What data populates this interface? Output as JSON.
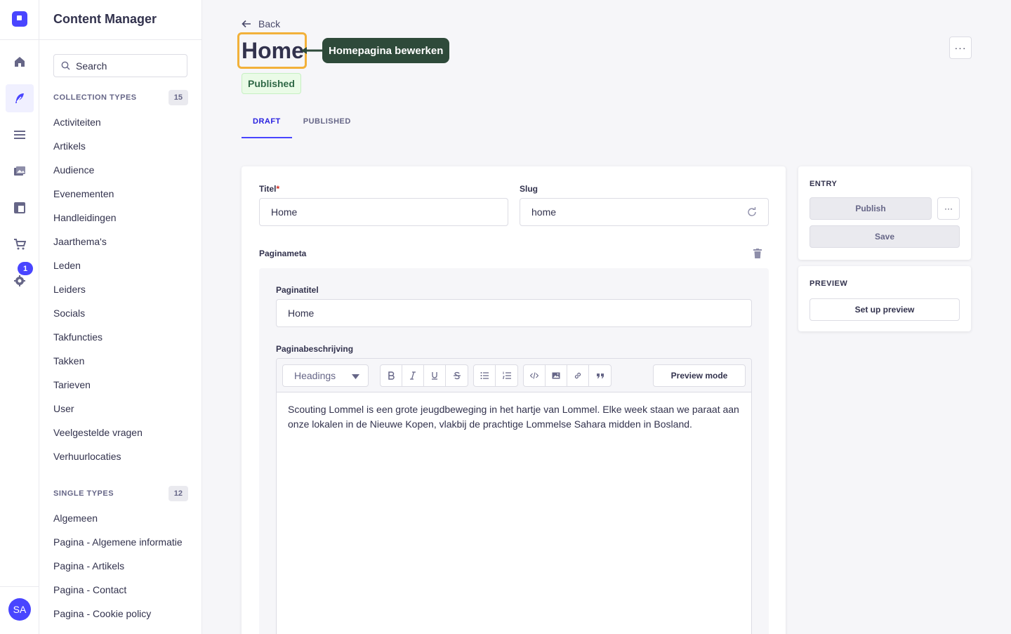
{
  "rail": {
    "items": [
      "home-icon",
      "feather-icon",
      "list-icon",
      "image-icon",
      "layout-icon",
      "cart-icon",
      "gear-icon"
    ],
    "settings_badge": "1",
    "avatar_initials": "SA",
    "accent": "#4945ff"
  },
  "subnav": {
    "title": "Content Manager",
    "search_placeholder": "Search",
    "collection_types": {
      "label": "COLLECTION TYPES",
      "count": "15",
      "items": [
        "Activiteiten",
        "Artikels",
        "Audience",
        "Evenementen",
        "Handleidingen",
        "Jaarthema's",
        "Leden",
        "Leiders",
        "Socials",
        "Takfuncties",
        "Takken",
        "Tarieven",
        "User",
        "Veelgestelde vragen",
        "Verhuurlocaties"
      ]
    },
    "single_types": {
      "label": "SINGLE TYPES",
      "count": "12",
      "items": [
        "Algemeen",
        "Pagina - Algemene informatie",
        "Pagina - Artikels",
        "Pagina - Contact",
        "Pagina - Cookie policy"
      ]
    }
  },
  "header": {
    "back_label": "Back",
    "title": "Home",
    "callout": "Homepagina bewerken",
    "status": "Published",
    "more": "···"
  },
  "tabs": [
    {
      "label": "DRAFT",
      "active": true
    },
    {
      "label": "PUBLISHED",
      "active": false
    }
  ],
  "form": {
    "titel_label": "Titel",
    "titel_required": "*",
    "titel_value": "Home",
    "slug_label": "Slug",
    "slug_value": "home",
    "component_label": "Paginameta",
    "paginatitel_label": "Paginatitel",
    "paginatitel_value": "Home",
    "beschrijving_label": "Paginabeschrijving",
    "headings_select": "Headings",
    "preview_mode": "Preview mode",
    "beschrijving_value": "Scouting Lommel is een grote jeugdbeweging in het hartje van Lommel. Elke week staan we paraat aan onze lokalen in de Nieuwe Kopen, vlakbij de prachtige Lommelse Sahara midden in Bosland."
  },
  "entry_panel": {
    "label": "ENTRY",
    "publish": "Publish",
    "more": "···",
    "save": "Save"
  },
  "preview_panel": {
    "label": "PREVIEW",
    "setup": "Set up preview"
  }
}
